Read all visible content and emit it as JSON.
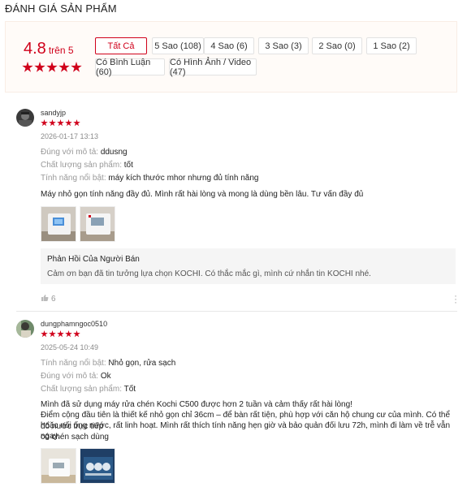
{
  "page_title": "ĐÁNH GIÁ SẢN PHẨM",
  "summary": {
    "score": "4.8",
    "out_of": "trên 5",
    "rating_stars": 5,
    "accent_color": "#d0011b",
    "filters": [
      {
        "label": "Tất Cả",
        "active": true
      },
      {
        "label": "5 Sao (108)",
        "active": false
      },
      {
        "label": "4 Sao (6)",
        "active": false
      },
      {
        "label": "3 Sao (3)",
        "active": false
      },
      {
        "label": "2 Sao (0)",
        "active": false
      },
      {
        "label": "1 Sao (2)",
        "active": false
      },
      {
        "label": "Có Bình Luận (60)",
        "active": false
      },
      {
        "label": "Có Hình Ảnh / Video (47)",
        "active": false
      }
    ]
  },
  "reviews": [
    {
      "username": "sandyjp",
      "rating_stars": 5,
      "date": "2026-01-17 13:13",
      "attributes": [
        {
          "key": "Đúng với mô tả:",
          "value": "ddusng"
        },
        {
          "key": "Chất lượng sản phẩm:",
          "value": "tốt"
        },
        {
          "key": "Tính năng nổi bật:",
          "value": "máy kích thước mhor nhưng đủ tính năng"
        }
      ],
      "text": [
        "Máy nhỏ gọn tính năng đầy đủ. Mình rất hài lòng và mong là dùng bền lâu. Tư vấn đầy đủ"
      ],
      "images": [
        "dishwasher-photo",
        "dishwasher-photo"
      ],
      "seller_reply": {
        "title": "Phản Hồi Của Người Bán",
        "text": "Cảm ơn bạn đã tin tưởng lựa chọn KOCHI. Có thắc mắc gì, mình cứ nhắn tin KOCHI nhé."
      },
      "likes": "6"
    },
    {
      "username": "dungphamngoc0510",
      "rating_stars": 5,
      "date": "2025-05-24 10:49",
      "attributes": [
        {
          "key": "Tính năng nổi bật:",
          "value": "Nhỏ gọn, rửa sạch"
        },
        {
          "key": "Đúng với mô tả:",
          "value": "Ok"
        },
        {
          "key": "Chất lượng sản phẩm:",
          "value": "Tốt"
        }
      ],
      "text": [
        "Mình đã sử dụng máy rửa chén Kochi C500 được hơn 2 tuần và cảm thấy rất hài lòng!",
        "Điểm cộng đầu tiên là thiết kế nhỏ gọn chỉ 36cm – để bàn rất tiện, phù hợp với căn hộ chung cư của mình. Có thể đổ nước trực tiếp",
        "hoặc nối ống nước, rất linh hoạt. Mình rất thích tính năng hẹn giờ và bảo quản đối lưu 72h, mình đi làm về trễ vẫn có chén sạch dùng",
        "ngay."
      ],
      "images": [
        "dishwasher-photo",
        "dishes-rack-photo"
      ]
    }
  ]
}
